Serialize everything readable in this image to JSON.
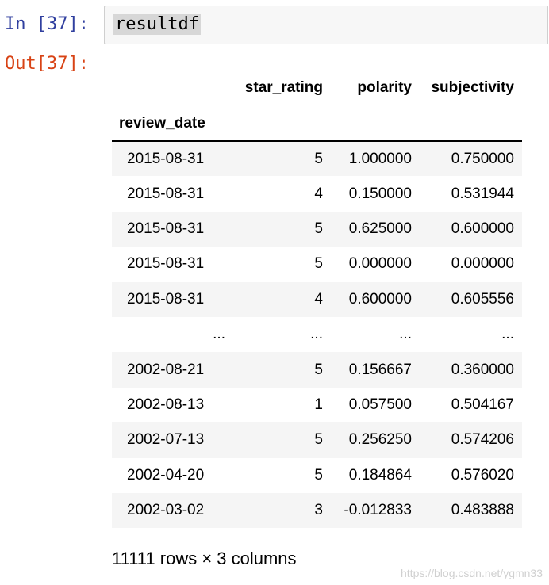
{
  "cell": {
    "in_prompt": "In [37]:",
    "out_prompt": "Out[37]:",
    "code": "resultdf"
  },
  "dataframe": {
    "columns": [
      "star_rating",
      "polarity",
      "subjectivity"
    ],
    "index_name": "review_date",
    "rows": [
      {
        "index": "2015-08-31",
        "values": [
          "5",
          "1.000000",
          "0.750000"
        ]
      },
      {
        "index": "2015-08-31",
        "values": [
          "4",
          "0.150000",
          "0.531944"
        ]
      },
      {
        "index": "2015-08-31",
        "values": [
          "5",
          "0.625000",
          "0.600000"
        ]
      },
      {
        "index": "2015-08-31",
        "values": [
          "5",
          "0.000000",
          "0.000000"
        ]
      },
      {
        "index": "2015-08-31",
        "values": [
          "4",
          "0.600000",
          "0.605556"
        ]
      },
      {
        "index": "...",
        "values": [
          "...",
          "...",
          "..."
        ]
      },
      {
        "index": "2002-08-21",
        "values": [
          "5",
          "0.156667",
          "0.360000"
        ]
      },
      {
        "index": "2002-08-13",
        "values": [
          "1",
          "0.057500",
          "0.504167"
        ]
      },
      {
        "index": "2002-07-13",
        "values": [
          "5",
          "0.256250",
          "0.574206"
        ]
      },
      {
        "index": "2002-04-20",
        "values": [
          "5",
          "0.184864",
          "0.576020"
        ]
      },
      {
        "index": "2002-03-02",
        "values": [
          "3",
          "-0.012833",
          "0.483888"
        ]
      }
    ],
    "shape_text": "11111 rows × 3 columns"
  },
  "watermark": "https://blog.csdn.net/ygmn33"
}
